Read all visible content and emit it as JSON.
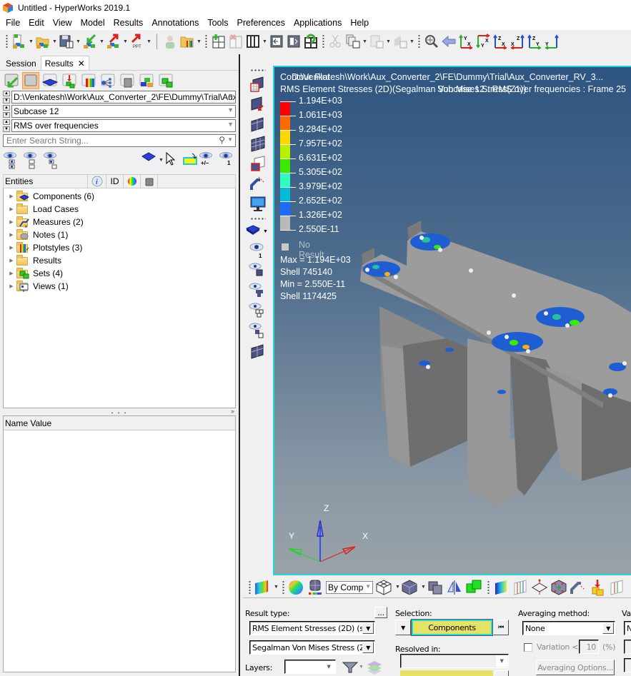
{
  "window": {
    "title": "Untitled - HyperWorks 2019.1",
    "app_icon": "hyperworks-logo-icon"
  },
  "menu": [
    "File",
    "Edit",
    "View",
    "Model",
    "Results",
    "Annotations",
    "Tools",
    "Preferences",
    "Applications",
    "Help"
  ],
  "toolbar": {
    "items": [
      "new-session-icon",
      "open-session-icon",
      "save-session-icon",
      "import-icon",
      "export-icon",
      "export-ppt-icon",
      "user-profile-icon",
      "open-results-folder-icon",
      "add-page-icon",
      "delete-page-icon",
      "page-layout-icon",
      "previous-page-icon",
      "next-page-icon",
      "reload-page-icon",
      "cut-icon",
      "copy-icon",
      "paste-icon",
      "paste-special-icon",
      "zoom-fit-icon",
      "back-arrow-icon",
      "view-xy-top-icon",
      "view-xy-bottom-icon",
      "view-xz-front-icon",
      "view-xz-rear-icon",
      "view-yz-left-icon",
      "view-yz-right-icon"
    ],
    "ppt_label": "PPT"
  },
  "left_panel": {
    "tabs": [
      {
        "label": "Session",
        "active": false
      },
      {
        "label": "Results",
        "active": true
      }
    ],
    "tab_close": "✕",
    "icon_bar": [
      "load-results-icon",
      "model-browser-icon",
      "components-icon",
      "import-results-icon",
      "contour-icon",
      "tree-view-icon",
      "solid-icon",
      "assemblies-icon",
      "sets-icon"
    ],
    "file_path": "D:\\Venkatesh\\Work\\Aux_Converter_2\\FE\\Dummy\\Trial\\Aux_",
    "subcase": "Subcase 12",
    "simulation": "RMS over frequencies",
    "search_placeholder": "Enter Search String...",
    "eye_tools": [
      "show-all-icon",
      "show-selected-icon",
      "reverse-display-icon"
    ],
    "eye_tools_right": {
      "plus_minus": "+/–",
      "one": "1"
    },
    "entities_header": {
      "entities": "Entities",
      "id": "ID"
    },
    "tree": [
      {
        "label": "Components (6)",
        "icon": "components-folder-icon"
      },
      {
        "label": "Load Cases",
        "icon": "folder-icon"
      },
      {
        "label": "Measures (2)",
        "icon": "measures-folder-icon"
      },
      {
        "label": "Notes (1)",
        "icon": "notes-folder-icon"
      },
      {
        "label": "Plotstyles (3)",
        "icon": "plotstyles-folder-icon"
      },
      {
        "label": "Results",
        "icon": "folder-icon"
      },
      {
        "label": "Sets (4)",
        "icon": "sets-folder-icon"
      },
      {
        "label": "Views (1)",
        "icon": "views-folder-icon"
      }
    ],
    "name_value_header": "Name Value"
  },
  "viewport": {
    "header_line1": "Contour Plot",
    "header_line1_overlap": "D:\\Venkatesh\\Work\\Aux_Converter_2\\FE\\Dummy\\Trial\\Aux_Converter_RV_3...",
    "header_line2": "RMS Element Stresses (2D)(Segalman Von Mises Stress(Z1))",
    "header_line2_overlap": "Subcase 12 : RMS over frequencies : Frame 25",
    "legend": {
      "labels": [
        "1.194E+03",
        "1.061E+03",
        "9.284E+02",
        "7.957E+02",
        "6.631E+02",
        "5.305E+02",
        "3.979E+02",
        "2.652E+02",
        "1.326E+02",
        "2.550E-11"
      ],
      "colors": [
        "#ff0000",
        "#ff6a00",
        "#ffd800",
        "#b8f000",
        "#3ce800",
        "#2effbe",
        "#00bcd8",
        "#1c6cff",
        "#b9b9b9"
      ],
      "no_result": "No Result"
    },
    "stats": {
      "max": "Max =  1.194E+03",
      "max_elem": "Shell 745140",
      "min": "Min =  2.550E-11",
      "min_elem": "Shell 1174425"
    },
    "triad": {
      "x": "X",
      "y": "Y",
      "z": "Z"
    }
  },
  "vertical_toolbar": [
    "contour-plot-icon",
    "deformed-shape-icon",
    "vector-plot-icon",
    "tensor-plot-icon",
    "iso-surface-icon",
    "measure-icon",
    "display-icon",
    "components-display-icon",
    "show-one-icon",
    "show-element-icon",
    "show-attached-icon",
    "show-connected-icon",
    "reverse-selection-icon",
    "mesh-icon"
  ],
  "bottom_toolbar": {
    "color_by": "By Comp",
    "items": [
      "contour-legend-icon",
      "color-wheel-icon",
      "color-by-icon",
      "wireframe-icon",
      "shaded-icon",
      "feature-lines-icon",
      "mirror-icon",
      "sets-toggle-icon",
      "legend-icon",
      "iso-lines-icon",
      "section-cut-icon",
      "explode-icon",
      "measure-tool-icon",
      "query-icon",
      "graph-icon"
    ]
  },
  "bottom_panel": {
    "result_type_label": "Result type:",
    "result_type": "RMS Element Stresses (2D) (s)",
    "result_component": "Segalman Von Mises Stress (Z1",
    "more_button": "...",
    "layers_label": "Layers:",
    "layers_value": "",
    "selection_label": "Selection:",
    "selection_value": "Components",
    "resolved_label": "Resolved in:",
    "resolved_value": "",
    "averaging_label": "Averaging method:",
    "averaging_value": "None",
    "variation_label": "Variation <",
    "variation_value": "10",
    "variation_unit": "(%)",
    "variation_checked": false,
    "averaging_options": "Averaging Options...",
    "value_label_cut": "Va",
    "value_combo_cut": "N"
  }
}
